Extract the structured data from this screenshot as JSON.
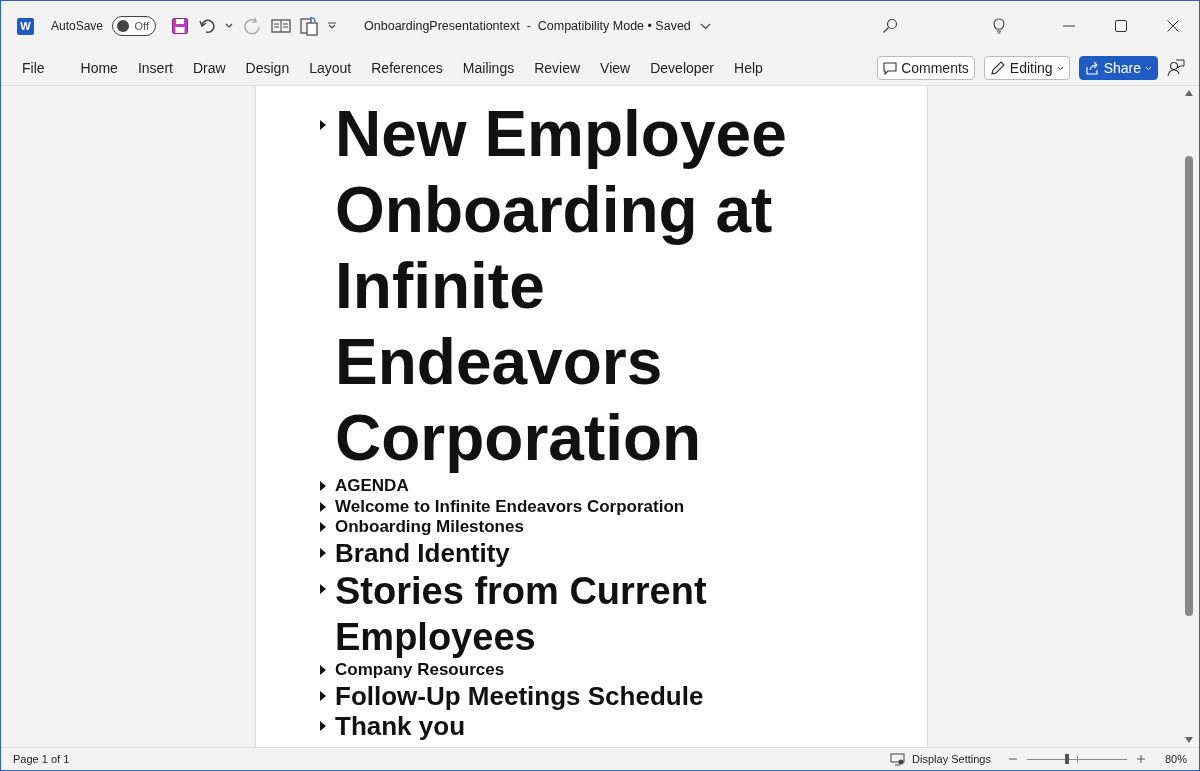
{
  "title_bar": {
    "app_icon_letter": "W",
    "autosave_label": "AutoSave",
    "autosave": {
      "on": false,
      "label": "Off"
    },
    "document_title": "OnboardingPresentationtext  -  Compatibility Mode • Saved"
  },
  "ribbon_tabs": [
    {
      "label": "File",
      "selected": false
    },
    {
      "label": "Home",
      "selected": false
    },
    {
      "label": "Insert",
      "selected": false
    },
    {
      "label": "Draw",
      "selected": false
    },
    {
      "label": "Design",
      "selected": false
    },
    {
      "label": "Layout",
      "selected": false
    },
    {
      "label": "References",
      "selected": false
    },
    {
      "label": "Mailings",
      "selected": false
    },
    {
      "label": "Review",
      "selected": false
    },
    {
      "label": "View",
      "selected": false
    },
    {
      "label": "Developer",
      "selected": false
    },
    {
      "label": "Help",
      "selected": false
    }
  ],
  "ribbon_buttons": {
    "comments": "Comments",
    "editing": "Editing",
    "share": "Share"
  },
  "outline": [
    {
      "kind": "title",
      "text": "New Employee Onboarding at Infinite Endeavors Corporation"
    },
    {
      "kind": "small",
      "text": "AGENDA"
    },
    {
      "kind": "small",
      "text": "Welcome to Infinite Endeavors Corporation"
    },
    {
      "kind": "small",
      "text": "Onboarding Milestones"
    },
    {
      "kind": "medium",
      "text": "Brand Identity"
    },
    {
      "kind": "large",
      "text": "Stories from Current Employees"
    },
    {
      "kind": "small",
      "text": "Company Resources"
    },
    {
      "kind": "medium",
      "text": "Follow-Up Meetings Schedule"
    },
    {
      "kind": "medium",
      "text": "Thank you"
    }
  ],
  "status_bar": {
    "page": "Page 1 of 1",
    "display_settings": "Display Settings",
    "zoom": {
      "level": 0.4
    },
    "zoom_text": "80%"
  }
}
